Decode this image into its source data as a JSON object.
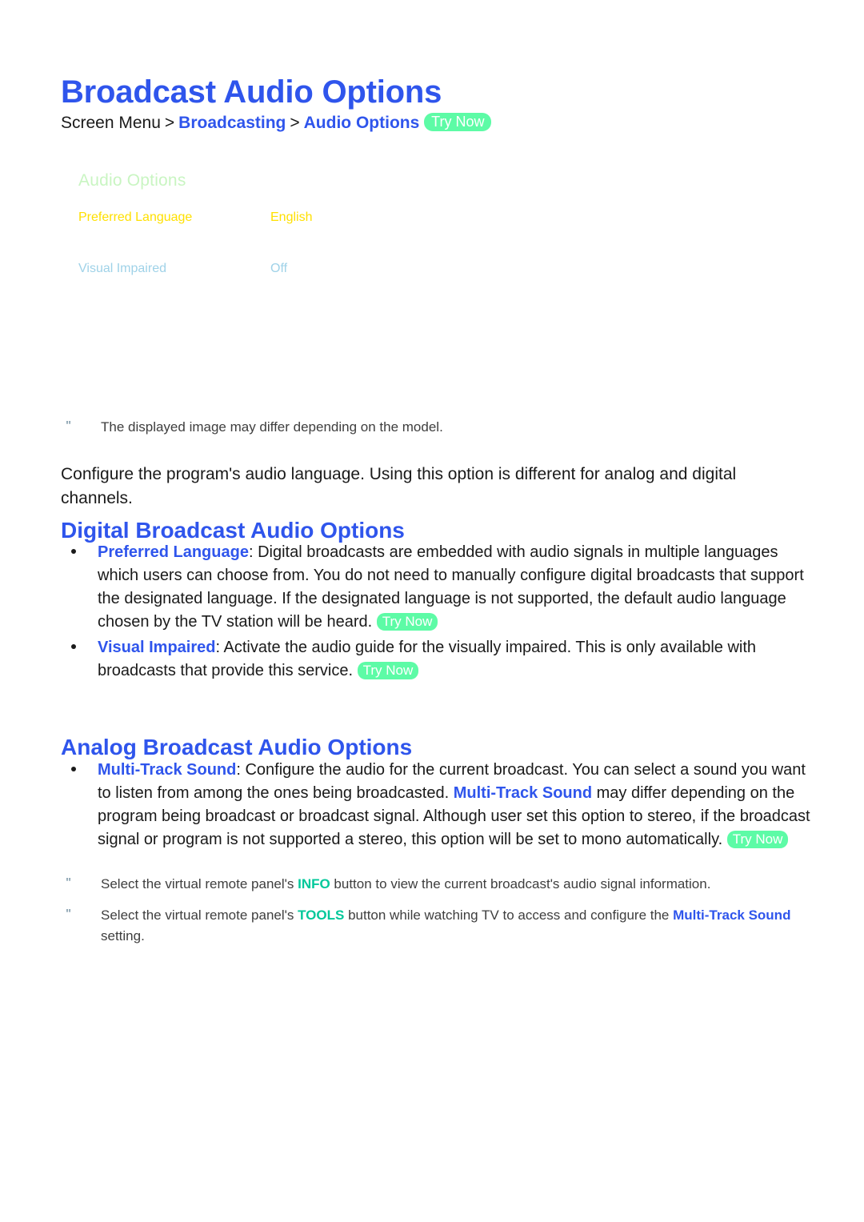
{
  "document": {
    "title": "Broadcast Audio Options"
  },
  "breadcrumb": {
    "root": "Screen Menu",
    "separator": ">",
    "level1": "Broadcasting",
    "level2": "Audio Options",
    "try_now": "Try Now"
  },
  "tv_menu": {
    "title": "Audio Options",
    "title_color": "#c9f5c2",
    "rows": [
      {
        "label": "Preferred Language",
        "value": "English",
        "color": "#ffe000"
      },
      {
        "label": "Visual Impaired",
        "value": "Off",
        "color": "#9fd2e8"
      }
    ]
  },
  "notes": {
    "mark": "\"",
    "model_note": "The displayed image may differ depending on the model.",
    "info_note_pre": "Select the virtual remote panel's ",
    "info_note_key": "INFO",
    "info_note_post": " button to view the current broadcast's audio signal information.",
    "tools_note_pre": "Select the virtual remote panel's ",
    "tools_note_key": "TOOLS",
    "tools_note_mid": " button while watching TV to access and configure the ",
    "tools_note_link": "Multi-Track Sound",
    "tools_note_post": " setting."
  },
  "intro": {
    "text": "Configure the program's audio language. Using this option is different for analog and digital channels."
  },
  "sections": {
    "digital": {
      "heading": "Digital Broadcast Audio Options",
      "bullets": [
        {
          "term": "Preferred Language",
          "body": ": Digital broadcasts are embedded with audio signals in multiple languages which users can choose from. You do not need to manually configure digital broadcasts that support the designated language. If the designated language is not supported, the default audio language chosen by the TV station will be heard. ",
          "try_now": "Try Now"
        },
        {
          "term": "Visual Impaired",
          "body": ": Activate the audio guide for the visually impaired. This is only available with broadcasts that provide this service. ",
          "try_now": "Try Now"
        }
      ]
    },
    "analog": {
      "heading": "Analog Broadcast Audio Options",
      "bullet": {
        "term": "Multi-Track Sound",
        "body_part1": ": Configure the audio for the current broadcast. You can select a sound you want to listen from among the ones being broadcasted. ",
        "inline_link": "Multi-Track Sound",
        "body_part2": " may differ depending on the program being broadcast or broadcast signal. Although user set this option to stereo, if the broadcast signal or program is not supported a stereo, this option will be set to mono automatically. ",
        "try_now": "Try Now"
      }
    }
  },
  "colors": {
    "heading_blue": "#2f55ec",
    "link_blue": "#2f55ec",
    "badge_green": "#5dfba6",
    "key_teal": "#00c89a",
    "body_text": "#1a1a1a",
    "note_text": "#3e3e3e",
    "background": "#ffffff"
  }
}
